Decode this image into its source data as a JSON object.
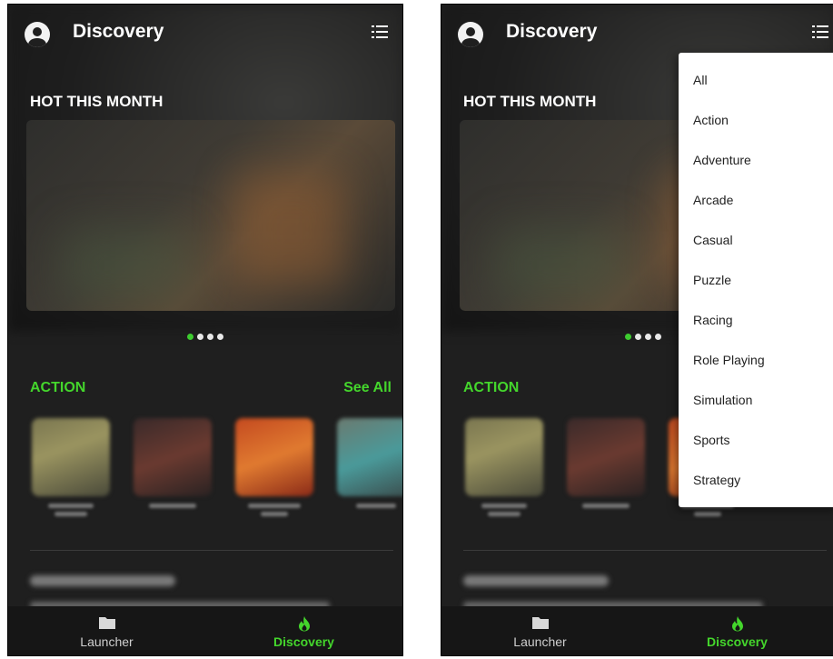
{
  "header": {
    "title": "Discovery"
  },
  "hot": {
    "title": "HOT THIS MONTH"
  },
  "action": {
    "title": "ACTION",
    "see_all": "See All"
  },
  "nav": {
    "launcher": "Launcher",
    "discovery": "Discovery"
  },
  "colors": {
    "accent": "#44d62c",
    "background": "#1f1f1f"
  },
  "carousel": {
    "pages": 4,
    "active_index": 0
  },
  "dropdown": {
    "items": [
      "All",
      "Action",
      "Adventure",
      "Arcade",
      "Casual",
      "Puzzle",
      "Racing",
      "Role Playing",
      "Simulation",
      "Sports",
      "Strategy"
    ]
  }
}
